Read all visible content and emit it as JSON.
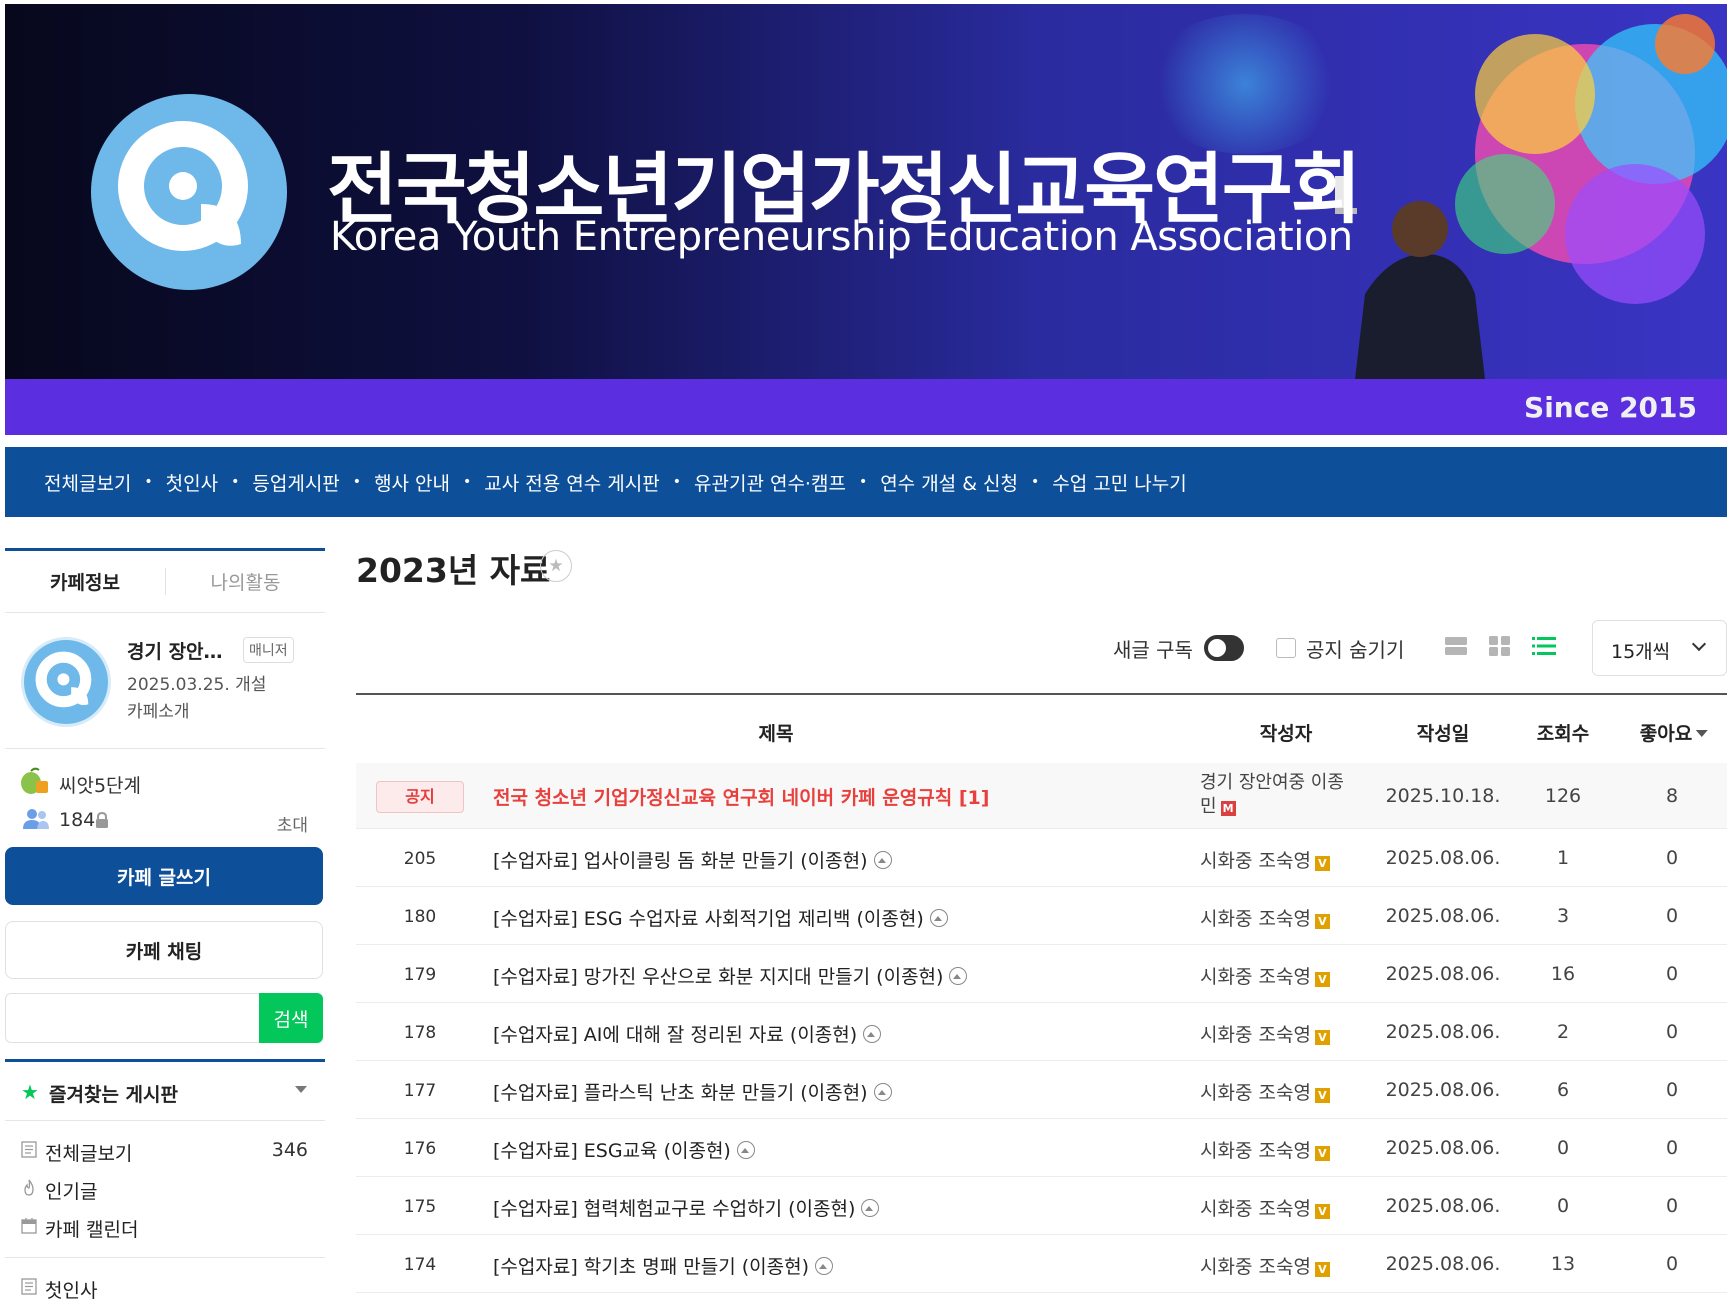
{
  "banner": {
    "title": "전국청소년기업가정신교육연구회",
    "subtitle": "Korea Youth Entrepreneurship Education Association",
    "since": "Since 2015"
  },
  "nav": {
    "items": [
      "전체글보기",
      "첫인사",
      "등업게시판",
      "행사 안내",
      "교사 전용 연수 게시판",
      "유관기관 연수·캠프",
      "연수 개설 & 신청",
      "수업 고민 나누기"
    ],
    "separator": "•"
  },
  "sidebar": {
    "tabs": {
      "info": "카페정보",
      "my": "나의활동"
    },
    "profile": {
      "name": "경기 장안…",
      "role": "매니저",
      "opened": "2025.03.25. 개설",
      "intro": "카페소개"
    },
    "level": "씨앗5단계",
    "members": "184",
    "invite": "초대",
    "write_button": "카페 글쓰기",
    "chat_button": "카페 채팅",
    "search": {
      "placeholder": "",
      "button": "검색"
    },
    "favorites": {
      "star": "★",
      "title": "즐겨찾는 게시판"
    },
    "menu": [
      {
        "label": "전체글보기",
        "count": "346",
        "icon": "list-icon"
      },
      {
        "label": "인기글",
        "count": "",
        "icon": "fire-icon"
      },
      {
        "label": "카페 캘린더",
        "count": "",
        "icon": "calendar-icon"
      }
    ],
    "menu2": [
      {
        "label": "첫인사",
        "icon": "list-icon"
      }
    ]
  },
  "board": {
    "title": "2023년 자료",
    "star": "★",
    "toolbar": {
      "subscribe": "새글 구독",
      "hide_notice": "공지 숨기기",
      "page_size": "15개씩"
    },
    "columns": {
      "title": "제목",
      "author": "작성자",
      "date": "작성일",
      "views": "조회수",
      "likes": "좋아요"
    },
    "notice": {
      "badge": "공지",
      "title": "전국 청소년 기업가정신교육 연구회 네이버 카페 운영규칙 [1]",
      "author": "경기 장안여중 이종민",
      "rank": "M",
      "date": "2025.10.18.",
      "views": "126",
      "likes": "8"
    },
    "rows": [
      {
        "num": "205",
        "title": "[수업자료] 업사이클링 돔 화분 만들기 (이종현)",
        "author": "시화중 조숙영",
        "rank": "V",
        "date": "2025.08.06.",
        "views": "1",
        "likes": "0"
      },
      {
        "num": "180",
        "title": "[수업자료] ESG 수업자료 사회적기업 제리백 (이종현)",
        "author": "시화중 조숙영",
        "rank": "V",
        "date": "2025.08.06.",
        "views": "3",
        "likes": "0"
      },
      {
        "num": "179",
        "title": "[수업자료] 망가진 우산으로 화분 지지대 만들기 (이종현)",
        "author": "시화중 조숙영",
        "rank": "V",
        "date": "2025.08.06.",
        "views": "16",
        "likes": "0"
      },
      {
        "num": "178",
        "title": "[수업자료] AI에 대해 잘 정리된 자료 (이종현)",
        "author": "시화중 조숙영",
        "rank": "V",
        "date": "2025.08.06.",
        "views": "2",
        "likes": "0"
      },
      {
        "num": "177",
        "title": "[수업자료] 플라스틱 난초 화분 만들기 (이종현)",
        "author": "시화중 조숙영",
        "rank": "V",
        "date": "2025.08.06.",
        "views": "6",
        "likes": "0"
      },
      {
        "num": "176",
        "title": "[수업자료] ESG교육 (이종현)",
        "author": "시화중 조숙영",
        "rank": "V",
        "date": "2025.08.06.",
        "views": "0",
        "likes": "0"
      },
      {
        "num": "175",
        "title": "[수업자료] 협력체험교구로 수업하기 (이종현)",
        "author": "시화중 조숙영",
        "rank": "V",
        "date": "2025.08.06.",
        "views": "0",
        "likes": "0"
      },
      {
        "num": "174",
        "title": "[수업자료] 학기초 명패 만들기 (이종현)",
        "author": "시화중 조숙영",
        "rank": "V",
        "date": "2025.08.06.",
        "views": "13",
        "likes": "0"
      }
    ]
  },
  "colors": {
    "nav_bg": "#0e4f9a",
    "banner_strip": "#5b2fe0",
    "search_green": "#03c75a",
    "notice_red": "#e8403c"
  }
}
